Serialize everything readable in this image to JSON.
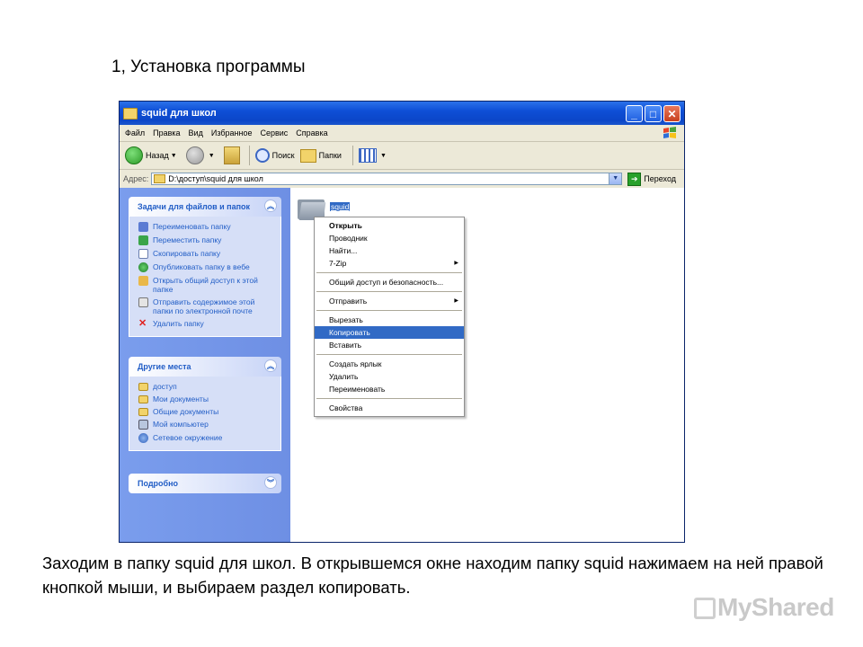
{
  "slide": {
    "heading": "1, Установка программы",
    "caption": "Заходим в папку squid для школ. В открывшемся окне находим папку squid нажимаем на ней правой кнопкой мыши, и выбираем раздел копировать.",
    "watermark": "MyShared"
  },
  "window": {
    "title": "squid для школ",
    "controls": {
      "minimize": "_",
      "maximize": "□",
      "close": "✕"
    }
  },
  "menubar": [
    "Файл",
    "Правка",
    "Вид",
    "Избранное",
    "Сервис",
    "Справка"
  ],
  "toolbar": {
    "back": "Назад",
    "search": "Поиск",
    "folders": "Папки"
  },
  "address": {
    "label": "Адрес:",
    "value": "D:\\доступ\\squid для школ",
    "go": "Переход"
  },
  "panels": {
    "tasks": {
      "title": "Задачи для файлов и папок",
      "items": [
        {
          "icon": "rename-icon",
          "label": "Переименовать папку"
        },
        {
          "icon": "move-icon",
          "label": "Переместить папку"
        },
        {
          "icon": "copy-icon",
          "label": "Скопировать папку"
        },
        {
          "icon": "web-publish-icon",
          "label": "Опубликовать папку в вебе"
        },
        {
          "icon": "share-icon",
          "label": "Открыть общий доступ к этой папке"
        },
        {
          "icon": "mail-icon",
          "label": "Отправить содержимое этой папки по электронной почте"
        },
        {
          "icon": "delete-icon",
          "label": "Удалить папку"
        }
      ]
    },
    "places": {
      "title": "Другие места",
      "items": [
        {
          "icon": "folder-icon",
          "label": "доступ"
        },
        {
          "icon": "my-documents-icon",
          "label": "Мои документы"
        },
        {
          "icon": "shared-documents-icon",
          "label": "Общие документы"
        },
        {
          "icon": "my-computer-icon",
          "label": "Мой компьютер"
        },
        {
          "icon": "network-icon",
          "label": "Сетевое окружение"
        }
      ]
    },
    "details": {
      "title": "Подробно"
    }
  },
  "content": {
    "selected_folder": "squid"
  },
  "context_menu": {
    "groups": [
      [
        {
          "label": "Открыть",
          "bold": true
        },
        {
          "label": "Проводник"
        },
        {
          "label": "Найти..."
        },
        {
          "label": "7-Zip",
          "submenu": true
        }
      ],
      [
        {
          "label": "Общий доступ и безопасность..."
        }
      ],
      [
        {
          "label": "Отправить",
          "submenu": true
        }
      ],
      [
        {
          "label": "Вырезать"
        },
        {
          "label": "Копировать",
          "highlighted": true
        },
        {
          "label": "Вставить"
        }
      ],
      [
        {
          "label": "Создать ярлык"
        },
        {
          "label": "Удалить"
        },
        {
          "label": "Переименовать"
        }
      ],
      [
        {
          "label": "Свойства"
        }
      ]
    ]
  },
  "colors": {
    "titlebar": "#0b46c8",
    "selection": "#316ac5",
    "task_pane": "#7a9ded",
    "link": "#215dc6"
  }
}
